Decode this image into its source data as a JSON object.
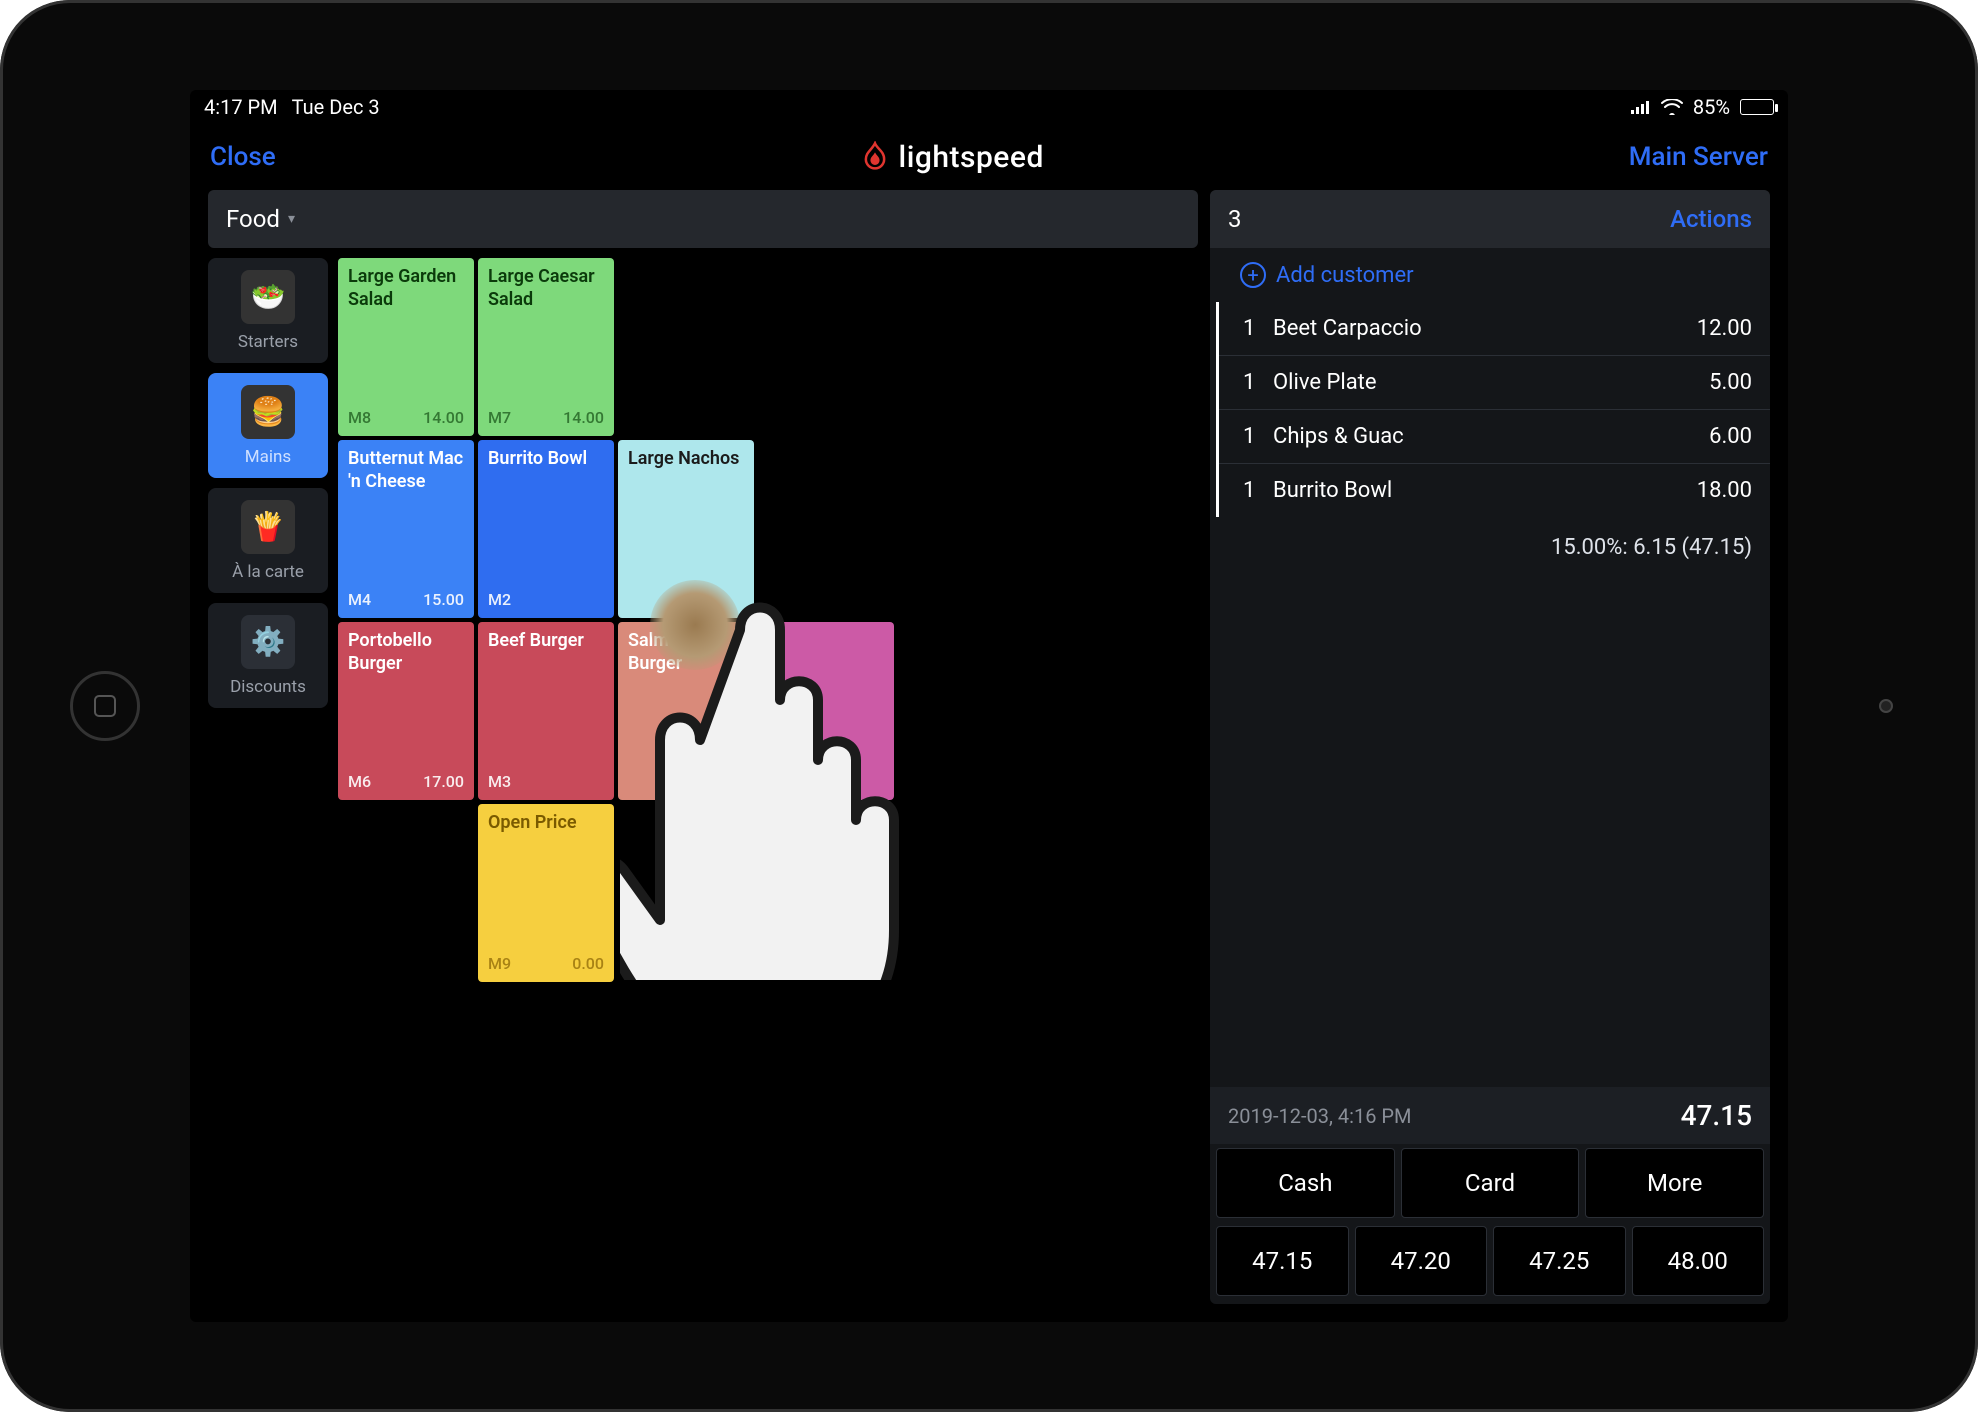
{
  "status": {
    "time": "4:17 PM",
    "date": "Tue Dec 3",
    "battery_pct": "85%"
  },
  "header": {
    "close": "Close",
    "brand": "lightspeed",
    "server": "Main Server"
  },
  "category_dropdown": "Food",
  "side_categories": [
    {
      "label": "Starters",
      "active": false
    },
    {
      "label": "Mains",
      "active": true
    },
    {
      "label": "À la carte",
      "active": false
    },
    {
      "label": "Discounts",
      "active": false
    }
  ],
  "products": [
    {
      "name": "Large Garden Salad",
      "code": "M8",
      "price": "14.00",
      "color": "c-green"
    },
    {
      "name": "Large Caesar Salad",
      "code": "M7",
      "price": "14.00",
      "color": "c-green"
    },
    {
      "name": "Butternut Mac 'n Cheese",
      "code": "M4",
      "price": "15.00",
      "color": "c-blue"
    },
    {
      "name": "Burrito Bowl",
      "code": "M2",
      "price": "",
      "color": "c-blue2"
    },
    {
      "name": "Large Nachos",
      "code": "",
      "price": "",
      "color": "c-cyan"
    },
    {
      "name": "Portobello Burger",
      "code": "M6",
      "price": "17.00",
      "color": "c-red"
    },
    {
      "name": "Beef Burger",
      "code": "M3",
      "price": "",
      "color": "c-red"
    },
    {
      "name": "Salmon Burger",
      "code": "",
      "price": "",
      "color": "c-salmon"
    },
    {
      "name": "",
      "code": "",
      "price": "",
      "color": "c-pink"
    },
    {
      "name": "Open Price",
      "code": "M9",
      "price": "0.00",
      "color": "c-yellow"
    }
  ],
  "order": {
    "table_no": "3",
    "actions_label": "Actions",
    "add_customer": "Add customer",
    "lines": [
      {
        "qty": "1",
        "name": "Beet Carpaccio",
        "price": "12.00"
      },
      {
        "qty": "1",
        "name": "Olive Plate",
        "price": "5.00"
      },
      {
        "qty": "1",
        "name": "Chips & Guac",
        "price": "6.00"
      },
      {
        "qty": "1",
        "name": "Burrito Bowl",
        "price": "18.00"
      }
    ],
    "tax_line": "15.00%: 6.15 (47.15)",
    "timestamp": "2019-12-03, 4:16 PM",
    "total": "47.15",
    "pay_methods": [
      "Cash",
      "Card",
      "More"
    ],
    "quick_amounts": [
      "47.15",
      "47.20",
      "47.25",
      "48.00"
    ]
  }
}
